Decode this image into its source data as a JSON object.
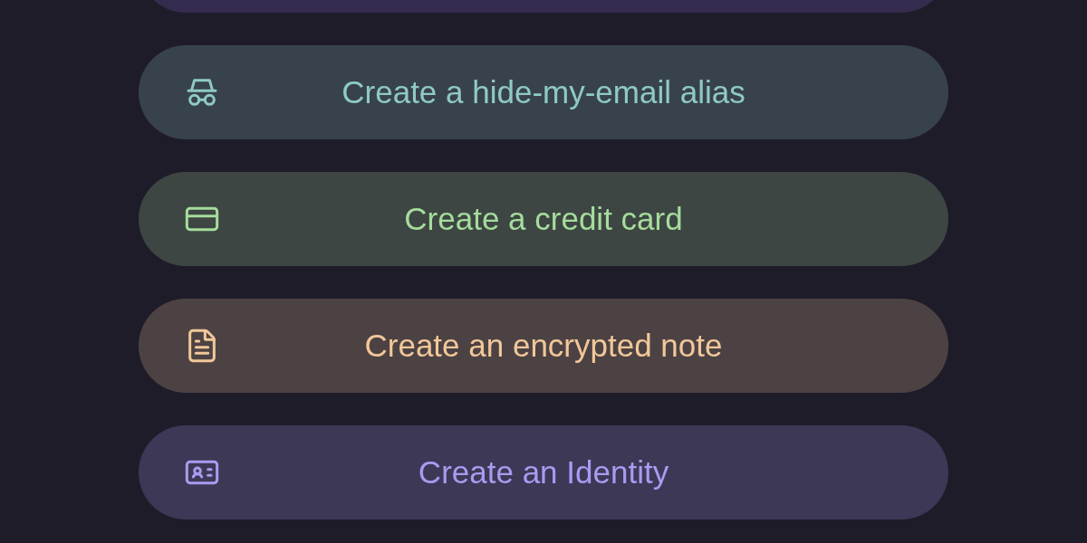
{
  "actions": [
    {
      "kind": "cut",
      "color": "#352b4f"
    },
    {
      "kind": "alias",
      "label": "Create a hide-my-email alias",
      "color": "#8fcac4"
    },
    {
      "kind": "card",
      "label": "Create a credit card",
      "color": "#a6dc9c"
    },
    {
      "kind": "note",
      "label": "Create an encrypted note",
      "color": "#f1c89a"
    },
    {
      "kind": "identity",
      "label": "Create an Identity",
      "color": "#a79cf0"
    }
  ]
}
